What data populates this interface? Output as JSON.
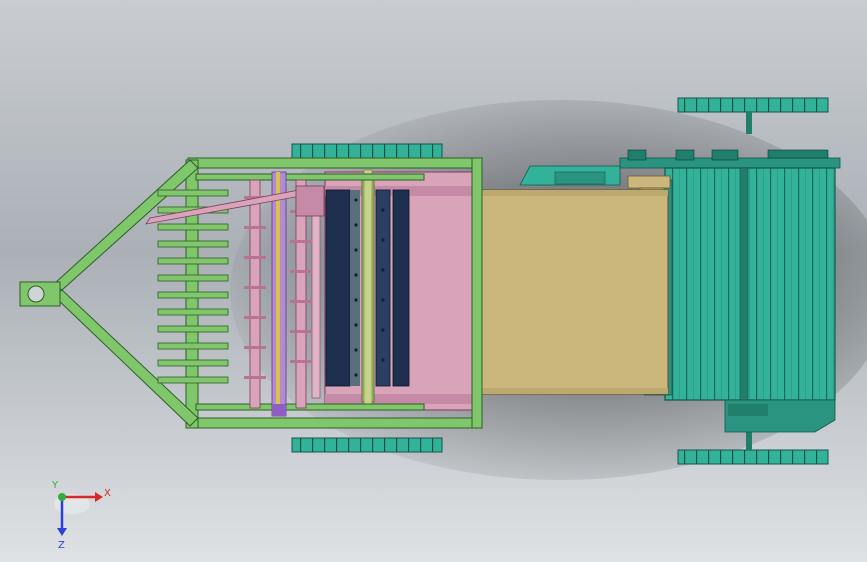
{
  "viewport": {
    "background_top": "#c9cdd2",
    "background_mid": "#aab0b6",
    "background_bottom": "#dfe2e5"
  },
  "colors": {
    "frame_green": "#7fc76a",
    "frame_edge": "#2f5d2a",
    "teal": "#33b29a",
    "teal_dark": "#1f7f6c",
    "teal_edge": "#145548",
    "pink": "#d9a3b9",
    "pink_dark": "#b77393",
    "violet": "#b48ad6",
    "tan": "#cbb77c",
    "tan_edge": "#6b5d32",
    "navy": "#1e2f4f",
    "blue_bearing": "#3d6fd8",
    "olive": "#9dbf6b",
    "sage": "#a8c89a"
  },
  "triad": {
    "x_label": "X",
    "y_label": "Y",
    "z_label": "Z",
    "x_color": "#d62a2a",
    "y_color": "#2fae3a",
    "z_color": "#2f3fd6"
  }
}
